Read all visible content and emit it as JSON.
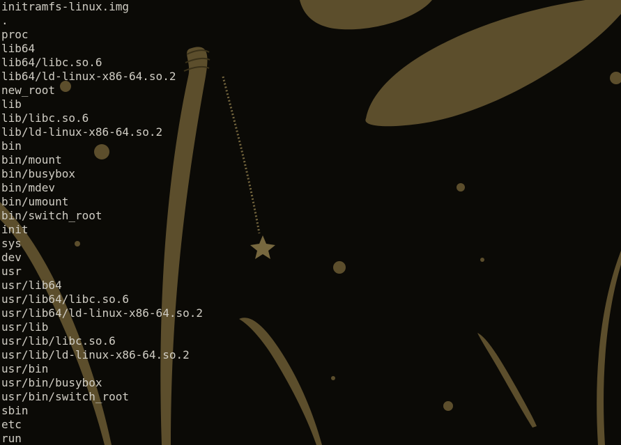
{
  "colors": {
    "background": "#0b0a06",
    "text": "#d0cdc4",
    "wallpaper_art": "#5c4e2c",
    "wallpaper_art_light": "#77683f"
  },
  "wallpaper": {
    "description_icon": "wallpaper-shapes"
  },
  "terminal": {
    "lines": [
      "initramfs-linux.img",
      ".",
      "proc",
      "lib64",
      "lib64/libc.so.6",
      "lib64/ld-linux-x86-64.so.2",
      "new_root",
      "lib",
      "lib/libc.so.6",
      "lib/ld-linux-x86-64.so.2",
      "bin",
      "bin/mount",
      "bin/busybox",
      "bin/mdev",
      "bin/umount",
      "bin/switch_root",
      "init",
      "sys",
      "dev",
      "usr",
      "usr/lib64",
      "usr/lib64/libc.so.6",
      "usr/lib64/ld-linux-x86-64.so.2",
      "usr/lib",
      "usr/lib/libc.so.6",
      "usr/lib/ld-linux-x86-64.so.2",
      "usr/bin",
      "usr/bin/busybox",
      "usr/bin/switch_root",
      "sbin",
      "etc",
      "run"
    ]
  }
}
